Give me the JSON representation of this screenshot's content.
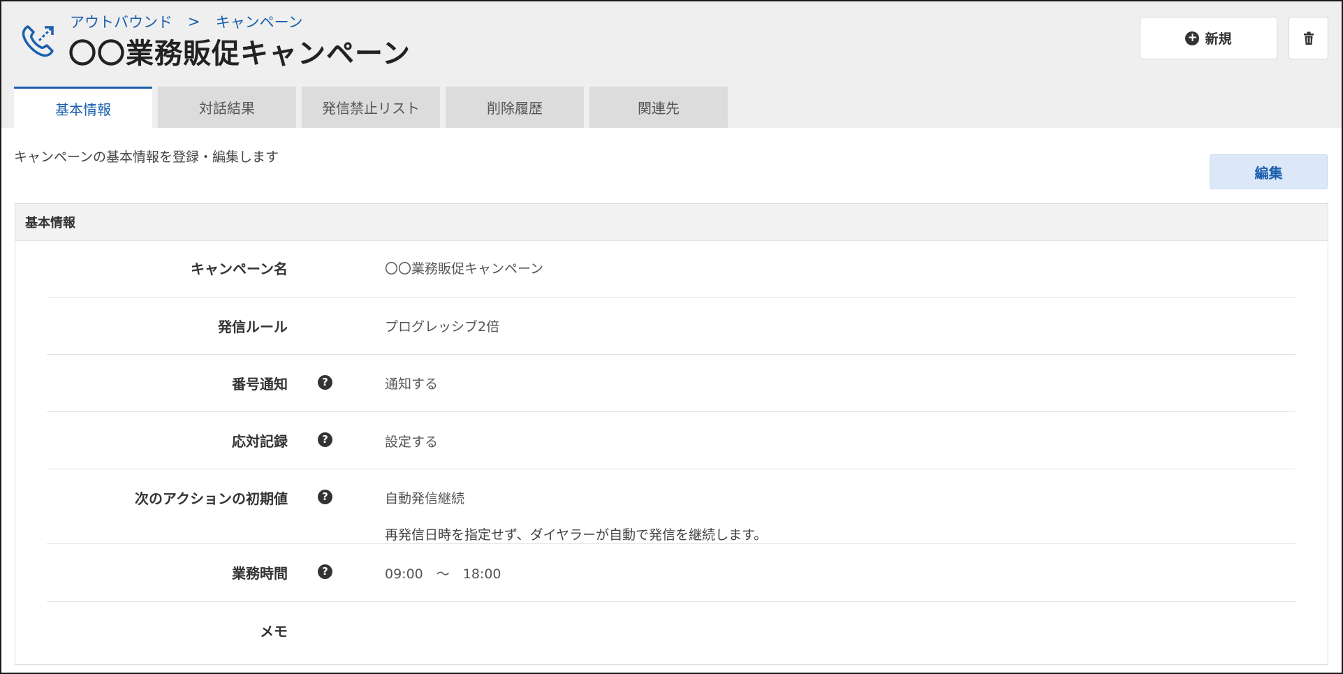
{
  "header": {
    "breadcrumb": {
      "parent": "アウトバウンド",
      "separator": ">",
      "current": "キャンペーン"
    },
    "title": "〇〇業務販促キャンペーン",
    "new_button_label": "新規",
    "icons": {
      "logo": "phone-outbound-icon",
      "new": "plus-circle-icon",
      "delete": "trash-icon"
    }
  },
  "tabs": [
    {
      "label": "基本情報",
      "active": true
    },
    {
      "label": "対話結果",
      "active": false
    },
    {
      "label": "発信禁止リスト",
      "active": false
    },
    {
      "label": "削除履歴",
      "active": false
    },
    {
      "label": "関連先",
      "active": false
    }
  ],
  "main": {
    "description": "キャンペーンの基本情報を登録・編集します",
    "edit_button_label": "編集",
    "panel": {
      "title": "基本情報",
      "rows": [
        {
          "label": "キャンペーン名",
          "value": "〇〇業務販促キャンペーン",
          "help": false
        },
        {
          "label": "発信ルール",
          "value": "プログレッシブ2倍",
          "help": false
        },
        {
          "label": "番号通知",
          "value": "通知する",
          "help": true
        },
        {
          "label": "応対記録",
          "value": "設定する",
          "help": true
        },
        {
          "label": "次のアクションの初期値",
          "value": "自動発信継続",
          "sub": "再発信日時を指定せず、ダイヤラーが自動で発信を継続します。",
          "help": true
        },
        {
          "label": "業務時間",
          "value": "09:00　～　18:00",
          "help": true
        },
        {
          "label": "メモ",
          "value": "",
          "help": false
        }
      ]
    }
  },
  "colors": {
    "accent": "#1b5fae",
    "header_bg": "#efefef",
    "tab_bg": "#dcdcdc",
    "edit_bg": "#dce7f8"
  }
}
